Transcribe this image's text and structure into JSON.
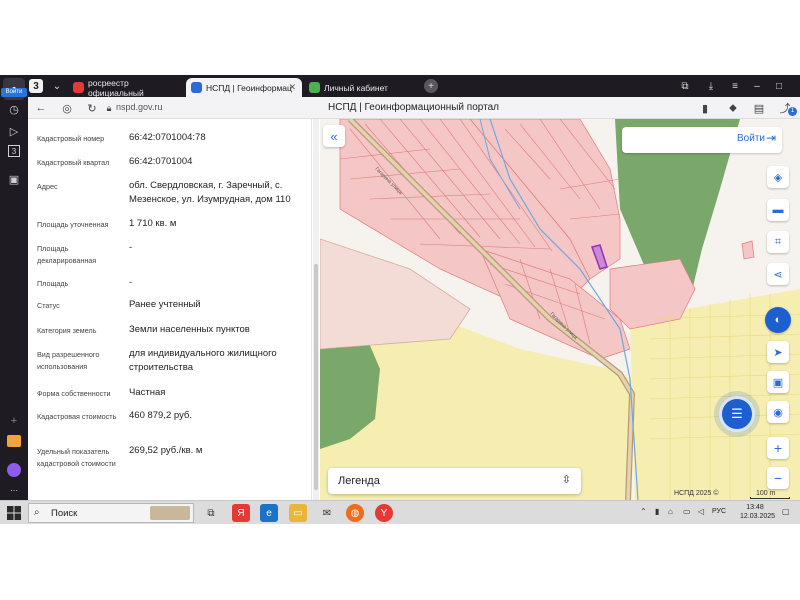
{
  "browser": {
    "sidebar_login": "Войти",
    "sidebar_badge": "3",
    "tabs": [
      {
        "label": "росреестр официальный"
      },
      {
        "label": "НСПД | Геоинформац"
      },
      {
        "label": "Личный кабинет"
      }
    ],
    "url": "nspd.gov.ru",
    "page_title": "НСПД | Геоинформационный портал",
    "extension_badge": "1"
  },
  "info": {
    "rows": [
      {
        "label": "Кадастровый номер",
        "value": "66:42:0701004:78"
      },
      {
        "label": "Кадастровый квартал",
        "value": "66:42:0701004"
      },
      {
        "label": "Адрес",
        "value": "обл. Свердловская, г. Заречный, с. Мезенское, ул. Изумрудная, дом 110"
      },
      {
        "label": "Площадь уточненная",
        "value": "1 710 кв. м"
      },
      {
        "label": "Площадь декларированная",
        "value": "-"
      },
      {
        "label": "Площадь",
        "value": "-"
      },
      {
        "label": "Статус",
        "value": "Ранее учтенный"
      },
      {
        "label": "Категория земель",
        "value": "Земли населенных пунктов"
      },
      {
        "label": "Вид разрешенного использования",
        "value": "для индивидуального жилищного строительства"
      },
      {
        "label": "Форма собственности",
        "value": "Частная"
      },
      {
        "label": "Кадастровая стоимость",
        "value": "460 879,2 руб."
      },
      {
        "label": "Удельный показатель кадастровой стоимости",
        "value": "269,52 руб./кв. м"
      }
    ]
  },
  "map": {
    "login_label": "Войти",
    "legend_label": "Легенда",
    "copyright": "НСПД 2025 ©",
    "scale": "100 m",
    "street_labels": [
      "Гагарина улица",
      "Гагарина улица"
    ],
    "colors": {
      "parcel": "#f4c6c6",
      "parcel_border": "#e07a7a",
      "forest": "#79a86a",
      "field": "#f6eeb0",
      "selected": "#9b2fb3",
      "accent": "#2b6bd8"
    }
  },
  "taskbar": {
    "search_label": "Поиск",
    "lang": "РУС",
    "time": "13:48",
    "date": "12.03.2025"
  }
}
